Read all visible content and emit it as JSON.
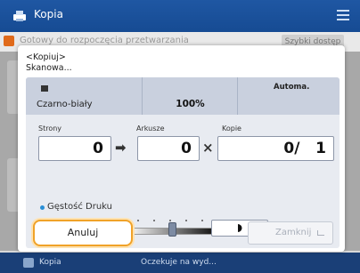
{
  "app": {
    "title": "Kopia"
  },
  "background": {
    "message": "Gotowy do rozpoczęcia przetwarzania",
    "button_label": "Szybki dostęp"
  },
  "statusbar": {
    "label": "Kopia",
    "message": "Oczekuje na wyd..."
  },
  "dialog": {
    "title_line1": "<Kopiuj>",
    "title_line2": "Skanowa...",
    "color_mode": "Czarno-biały",
    "zoom": "100%",
    "paper": "Automa.",
    "labels": {
      "pages": "Strony",
      "sheets": "Arkusze",
      "copies": "Kopie"
    },
    "values": {
      "pages": "0",
      "sheets": "0",
      "copies": "0/   1"
    },
    "operators": {
      "arrow": "➡",
      "times": "×"
    },
    "density": {
      "label": "Gęstość Druku",
      "level": 0.5
    },
    "cancel_label": "Anuluj",
    "close_label": "Zamknij"
  },
  "colors": {
    "accent": "#f0a228",
    "header": "#1f57a3",
    "panel": "#e8ebf1"
  }
}
